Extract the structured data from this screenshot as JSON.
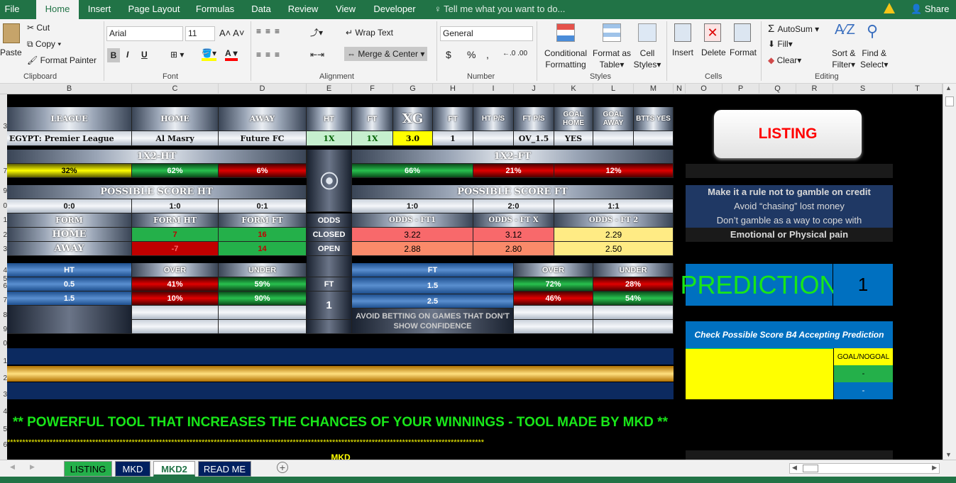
{
  "menu": {
    "tabs": [
      "File",
      "Home",
      "Insert",
      "Page Layout",
      "Formulas",
      "Data",
      "Review",
      "View",
      "Developer"
    ],
    "tell_me": "Tell me what you want to do...",
    "share": "Share"
  },
  "ribbon": {
    "clipboard": {
      "paste": "Paste",
      "cut": "Cut",
      "copy": "Copy",
      "format_painter": "Format Painter",
      "label": "Clipboard"
    },
    "font": {
      "name": "Arial",
      "size": "11",
      "bold": "B",
      "italic": "I",
      "underline": "U",
      "label": "Font"
    },
    "alignment": {
      "wrap_text": "Wrap Text",
      "merge_center": "Merge & Center",
      "label": "Alignment"
    },
    "number": {
      "format": "General",
      "currency": "$",
      "percent": "%",
      "comma": ",",
      "label": "Number"
    },
    "styles": {
      "conditional": "Conditional",
      "conditional2": "Formatting",
      "format_as": "Format as",
      "format_as2": "Table",
      "cell": "Cell",
      "cell2": "Styles",
      "label": "Styles"
    },
    "cells": {
      "insert": "Insert",
      "delete": "Delete",
      "format": "Format",
      "label": "Cells"
    },
    "editing": {
      "autosum": "AutoSum",
      "fill": "Fill",
      "clear": "Clear",
      "sort": "Sort &",
      "sort2": "Filter",
      "find": "Find &",
      "find2": "Select",
      "label": "Editing"
    }
  },
  "columns": [
    "B",
    "C",
    "D",
    "E",
    "F",
    "G",
    "H",
    "I",
    "J",
    "K",
    "L",
    "M",
    "N",
    "O",
    "P",
    "Q",
    "R",
    "S",
    "T"
  ],
  "rows": [
    "",
    "3",
    "",
    "",
    "",
    "",
    "7",
    "",
    "9",
    "0",
    "1",
    "2",
    "3",
    "4",
    "5",
    "6",
    "7",
    "8",
    "9",
    "0",
    "1",
    "2",
    "3",
    "4",
    "5",
    "6"
  ],
  "sheet": {
    "headers": {
      "league": "LEAGUE",
      "home": "HOME",
      "away": "AWAY",
      "ht": "HT",
      "ft": "FT",
      "xg": "XG",
      "ft2": "FT",
      "htps": "HT P/S",
      "ftps": "FT P/S",
      "goal_home": "GOAL HOME",
      "goal_away": "GOAL AWAY",
      "btts": "BTTS YES"
    },
    "match": {
      "league": "EGYPT: Premier League",
      "home": "Al Masry",
      "away": "Future FC",
      "ht": "1X",
      "ft": "1X",
      "xg": "3.0",
      "ft2": "1",
      "htps": "",
      "ftps": "OV_1.5",
      "goal_home": "YES",
      "goal_away": "",
      "btts": ""
    },
    "x12ht": {
      "title": "1X2-HT",
      "home": "32%",
      "draw": "62%",
      "away": "6%"
    },
    "x12ft": {
      "title": "1X2-FT",
      "home": "66%",
      "draw": "21%",
      "away": "12%"
    },
    "score_ht": {
      "title": "POSSIBLE SCORE HT",
      "s1": "0:0",
      "s2": "1:0",
      "s3": "0:1"
    },
    "score_ft": {
      "title": "POSSIBLE SCORE FT",
      "s1": "1:0",
      "s2": "2:0",
      "s3": "1:1"
    },
    "form": {
      "form": "FORM",
      "form_ht": "FORM HT",
      "form_ft": "FORM FT",
      "home": "HOME",
      "away": "AWAY",
      "home_ht": "7",
      "home_ft": "16",
      "away_ht": "-7",
      "away_ft": "14"
    },
    "odds": {
      "odds": "ODDS",
      "closed": "CLOSED",
      "open": "OPEN",
      "ft1": "ODDS - FT1",
      "ftx": "ODDS - FT X",
      "ft2": "ODDS - FT 2",
      "c1": "3.22",
      "cx": "3.12",
      "c2": "2.29",
      "o1": "2.88",
      "ox": "2.80",
      "o2": "2.50"
    },
    "ou_ht": {
      "ht": "HT",
      "over": "OVER",
      "under": "UNDER",
      "l1": "0.5",
      "o1": "41%",
      "u1": "59%",
      "l2": "1.5",
      "o2": "10%",
      "u2": "90%"
    },
    "ou_ft": {
      "ft": "FT",
      "over": "OVER",
      "under": "UNDER",
      "l1": "1.5",
      "o1": "72%",
      "u1": "28%",
      "l2": "2.5",
      "o2": "46%",
      "u2": "54%"
    },
    "mid": {
      "ft": "FT",
      "val": "1"
    },
    "avoid": "AVOID BETTING ON GAMES THAT DON'T SHOW CONFIDENCE",
    "banner": "** POWERFUL TOOL THAT INCREASES THE CHANCES OF YOUR WINNINGS - TOOL MADE BY MKD **",
    "stars": "*************************************************************************************************************************************************************",
    "mkd": "MKD",
    "listing_button": "LISTING",
    "rules": [
      "Make it a rule not to gamble on credit",
      "Avoid “chasing” lost money",
      "Don’t gamble as a way to cope with",
      "Emotional or Physical pain"
    ],
    "prediction": {
      "label": "PREDICTION",
      "value": "1"
    },
    "check": "Check Possible Score B4 Accepting Prediction",
    "goal_nogoal": "GOAL/NOGOAL",
    "gng1": "-",
    "gng2": "-"
  },
  "sheet_tabs": [
    "LISTING",
    "MKD",
    "MKD2",
    "READ ME"
  ],
  "colors": {
    "excel_green": "#217346",
    "accent_green": "#24b04a",
    "accent_red": "#c00000",
    "yellow": "#ffff00"
  }
}
